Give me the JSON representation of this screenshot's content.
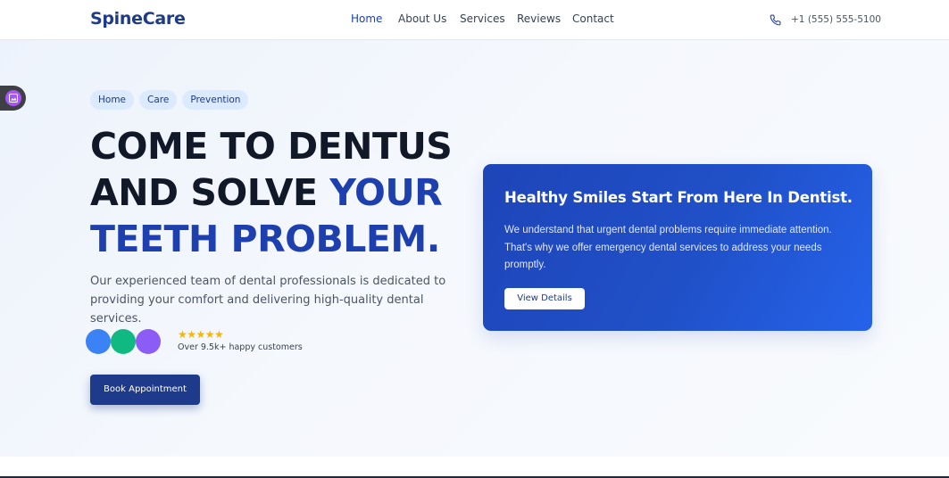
{
  "header": {
    "logo": "SpineCare",
    "nav": [
      {
        "label": "Home",
        "active": true
      },
      {
        "label": "About Us",
        "active": false
      },
      {
        "label": "Services",
        "active": false
      },
      {
        "label": "Reviews",
        "active": false
      },
      {
        "label": "Contact",
        "active": false
      }
    ],
    "phone_icon": "phone-icon",
    "phone": "+1 (555) 555-5100"
  },
  "hero": {
    "chips": [
      "Home",
      "Care",
      "Prevention"
    ],
    "title_line1": "COME TO DENTUS",
    "title_line2_a": "AND SOLVE ",
    "title_line2_b": "YOUR",
    "title_line3": "TEETH PROBLEM.",
    "description": "Our experienced team of dental professionals is dedicated to providing your comfort and delivering high-quality dental services.",
    "avatar_colors": [
      "#3b82f6",
      "#10b981",
      "#8b5cf6"
    ],
    "stars": "★★★★★",
    "rating_text": "Over 9.5k+ happy customers",
    "book_button": "Book Appointment"
  },
  "card": {
    "title": "Healthy Smiles Start From Here In Dentist.",
    "text": "We understand that urgent dental problems require immediate attention. That's why we offer emergency dental services to address your needs promptly.",
    "button": "View Details"
  },
  "colors": {
    "brand": "#1e3a8a",
    "accent": "#1e40af",
    "card": "#2050c8",
    "star": "#f5b50a"
  }
}
